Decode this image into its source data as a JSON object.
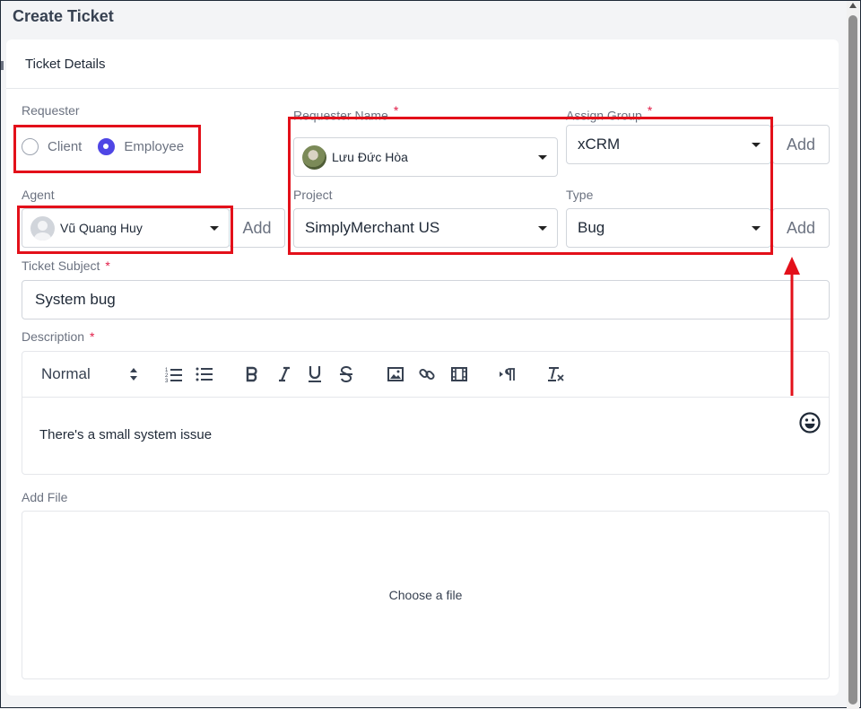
{
  "page": {
    "title": "Create Ticket"
  },
  "card": {
    "header": "Ticket Details"
  },
  "requester": {
    "label": "Requester",
    "options": [
      {
        "label": "Client",
        "checked": false
      },
      {
        "label": "Employee",
        "checked": true
      }
    ]
  },
  "requester_name": {
    "label": "Requester Name",
    "required_mark": "*",
    "value": "Lưu Đức Hòa"
  },
  "assign_group": {
    "label": "Assign Group",
    "required_mark": "*",
    "value": "xCRM",
    "add_label": "Add"
  },
  "agent": {
    "label": "Agent",
    "value": "Vũ Quang Huy",
    "add_label": "Add"
  },
  "project": {
    "label": "Project",
    "value": "SimplyMerchant US"
  },
  "type": {
    "label": "Type",
    "value": "Bug",
    "add_label": "Add"
  },
  "subject": {
    "label": "Ticket Subject",
    "required_mark": "*",
    "value": "System bug"
  },
  "description": {
    "label": "Description",
    "required_mark": "*",
    "format": "Normal",
    "text": "There's a small system issue",
    "toolbar_icons": [
      "ordered-list-icon",
      "bullet-list-icon",
      "bold-icon",
      "italic-icon",
      "underline-icon",
      "strike-icon",
      "image-icon",
      "link-icon",
      "video-icon",
      "text-direction-icon",
      "clear-format-icon"
    ]
  },
  "attachments": {
    "label": "Add File",
    "dropzone_text": "Choose a file"
  },
  "annotation": {
    "color": "#e3101a"
  }
}
